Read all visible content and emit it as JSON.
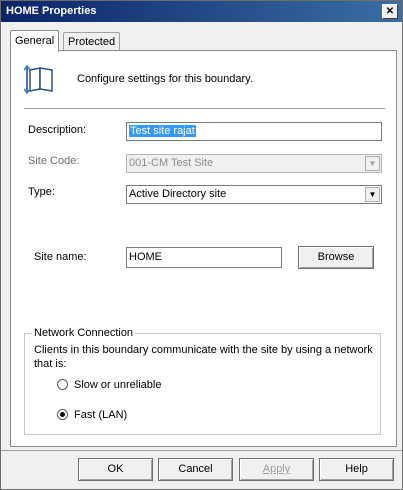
{
  "window": {
    "title": "HOME Properties",
    "close_glyph": "✕"
  },
  "tabs": [
    {
      "label": "General",
      "active": true
    },
    {
      "label": "Protected",
      "active": false
    }
  ],
  "header": {
    "text": "Configure settings for this boundary.",
    "icon": "book-boundary-icon"
  },
  "form": {
    "description_label": "Description:",
    "description_value": "Test site rajat",
    "site_code_label": "Site Code:",
    "site_code_value": "001-CM Test Site",
    "type_label": "Type:",
    "type_value": "Active Directory site",
    "site_name_label": "Site name:",
    "site_name_value": "HOME",
    "browse_label": "Browse"
  },
  "network": {
    "title": "Network Connection",
    "description_line1": "Clients in this boundary communicate with the site by using a network",
    "description_line2": "that is:",
    "options": [
      {
        "label": "Slow or unreliable",
        "selected": false
      },
      {
        "label": "Fast (LAN)",
        "selected": true
      }
    ]
  },
  "buttons": {
    "ok": "OK",
    "cancel": "Cancel",
    "apply": "Apply",
    "help": "Help"
  },
  "colors": {
    "titlebar": "#0a246a",
    "selection": "#3399ff",
    "panel": "#ffffff",
    "chrome": "#f0f0f0"
  }
}
